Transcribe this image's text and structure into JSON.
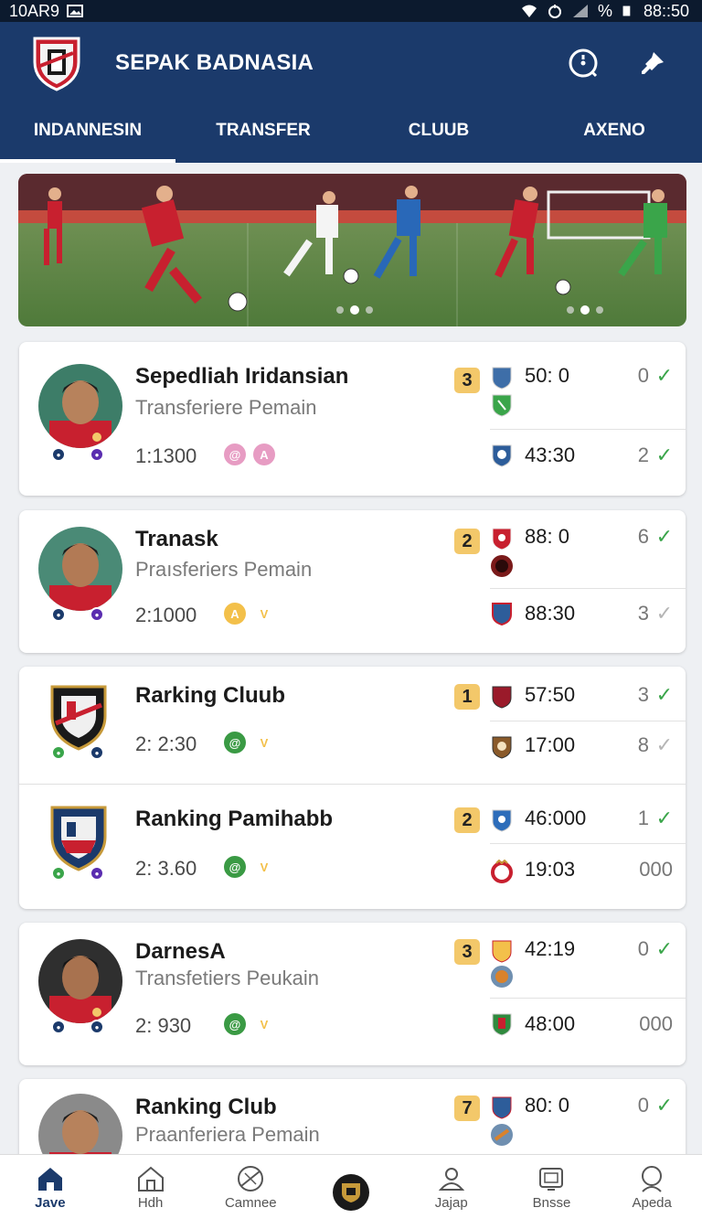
{
  "status_bar": {
    "carrier": "10AR9",
    "time": "88::50",
    "battery": "%"
  },
  "header": {
    "title": "SEPAK BADNASIA"
  },
  "tabs": [
    {
      "label": "INDANNESIN",
      "active": true
    },
    {
      "label": "TRANSFER",
      "active": false
    },
    {
      "label": "CLUUB",
      "active": false
    },
    {
      "label": "AXENO",
      "active": false
    }
  ],
  "colors": {
    "header": "#1b3a6b",
    "rank_badge": "#f3c86a",
    "check": "#3aa54a"
  },
  "cards": [
    {
      "name": "Sepedliah Iridansian",
      "subtitle": "Transferiere Pemain",
      "stat": "1:1300",
      "badges": [
        "@",
        "A"
      ],
      "rank": "3",
      "matches": [
        {
          "score": "50: 0",
          "value": "0",
          "check": true
        },
        {
          "score": "43:30",
          "value": "2",
          "check": true
        }
      ]
    },
    {
      "name": "Tranask",
      "subtitle": "Praısferiers Pemain",
      "stat": "2:1000",
      "badges": [
        "A",
        "V"
      ],
      "rank": "2",
      "matches": [
        {
          "score": "88: 0",
          "value": "6",
          "check": true
        },
        {
          "score": "88:30",
          "value": "3",
          "check": false
        }
      ]
    },
    {
      "name": "Rarking Cluub",
      "subtitle": "",
      "stat": "2: 2:30",
      "badges": [
        "@",
        "V"
      ],
      "rank": "1",
      "matches": [
        {
          "score": "57:50",
          "value": "3",
          "check": true
        },
        {
          "score": "17:00",
          "value": "8",
          "check": false
        }
      ]
    },
    {
      "name": "Ranking Pamihabb",
      "subtitle": "",
      "stat": "2: 3.60",
      "badges": [
        "@",
        "V"
      ],
      "rank": "2",
      "matches": [
        {
          "score": "46:000",
          "value": "1",
          "check": true
        },
        {
          "score": "19:03",
          "value": "000",
          "check": null
        }
      ]
    },
    {
      "name": "DarnesA",
      "subtitle": "Transfetiers Peukain",
      "stat": "2: 930",
      "badges": [
        "@",
        "V"
      ],
      "rank": "3",
      "matches": [
        {
          "score": "42:19",
          "value": "0",
          "check": true
        },
        {
          "score": "48:00",
          "value": "000",
          "check": null
        }
      ]
    },
    {
      "name": "Ranking Club",
      "subtitle": "Praanferiera Pemain",
      "stat": "",
      "badges": [],
      "rank": "7",
      "matches": [
        {
          "score": "80: 0",
          "value": "0",
          "check": true
        }
      ]
    }
  ],
  "bottom_nav": [
    {
      "label": "Jave",
      "icon": "home-icon",
      "active": true
    },
    {
      "label": "Hdh",
      "icon": "house-icon",
      "active": false
    },
    {
      "label": "Camnee",
      "icon": "ball-icon",
      "active": false
    },
    {
      "label": "",
      "icon": "club-crest-icon",
      "active": false
    },
    {
      "label": "Jajap",
      "icon": "person-icon",
      "active": false
    },
    {
      "label": "Bnsse",
      "icon": "tv-icon",
      "active": false
    },
    {
      "label": "Apeda",
      "icon": "search-person-icon",
      "active": false
    }
  ]
}
